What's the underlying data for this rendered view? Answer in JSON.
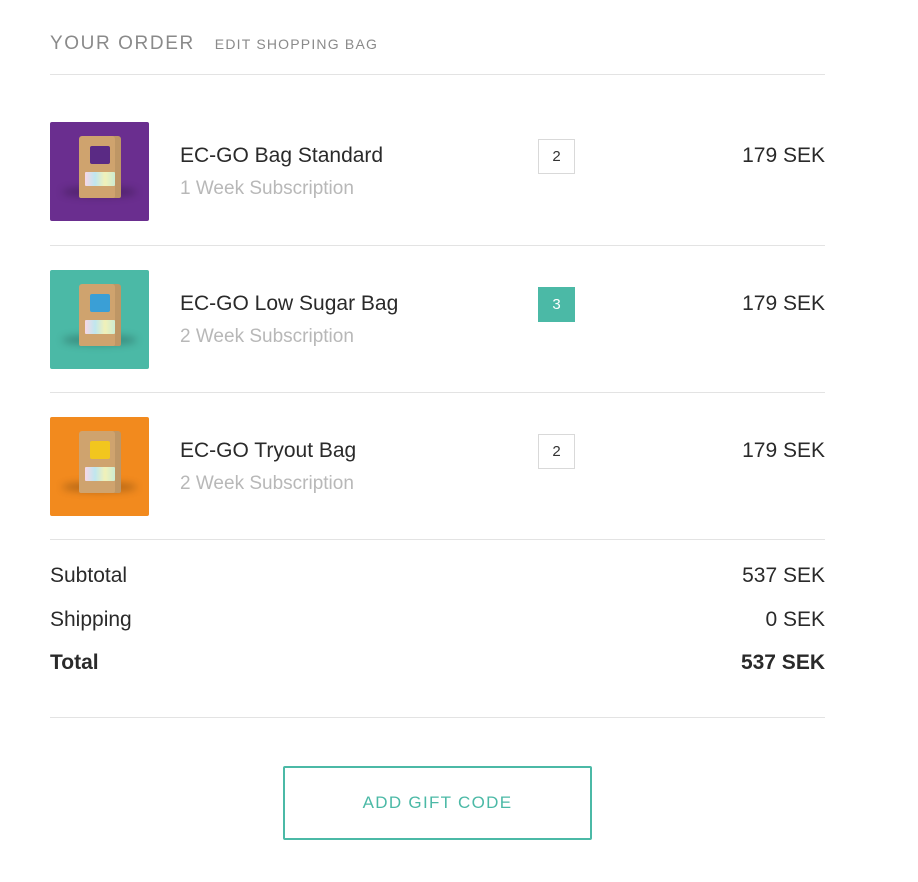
{
  "header": {
    "title": "YOUR ORDER",
    "edit_label": "EDIT SHOPPING BAG"
  },
  "items": [
    {
      "name": "EC-GO Bag Standard",
      "subscription": "1 Week Subscription",
      "quantity": "2",
      "quantity_selected": false,
      "price": "179 SEK",
      "thumb_color": "#6a2e8f",
      "label_color": "#5a2a84",
      "label_text": "EC GO"
    },
    {
      "name": "EC-GO Low Sugar Bag",
      "subscription": "2 Week Subscription",
      "quantity": "3",
      "quantity_selected": true,
      "price": "179 SEK",
      "thumb_color": "#4bb9a6",
      "label_color": "#3a9fd6",
      "label_text": "EC GO"
    },
    {
      "name": "EC-GO Tryout Bag",
      "subscription": "2 Week Subscription",
      "quantity": "2",
      "quantity_selected": false,
      "price": "179 SEK",
      "thumb_color": "#f28a1e",
      "label_color": "#f2c61e",
      "label_text": "EC GO"
    }
  ],
  "totals": {
    "subtotal_label": "Subtotal",
    "subtotal_value": "537 SEK",
    "shipping_label": "Shipping",
    "shipping_value": "0 SEK",
    "total_label": "Total",
    "total_value": "537 SEK"
  },
  "gift": {
    "button_label": "ADD GIFT CODE"
  },
  "colors": {
    "accent": "#4bb9a6",
    "muted_text": "#8a8a8a",
    "subtext": "#b8b8b8",
    "divider": "#e3e3e3"
  }
}
